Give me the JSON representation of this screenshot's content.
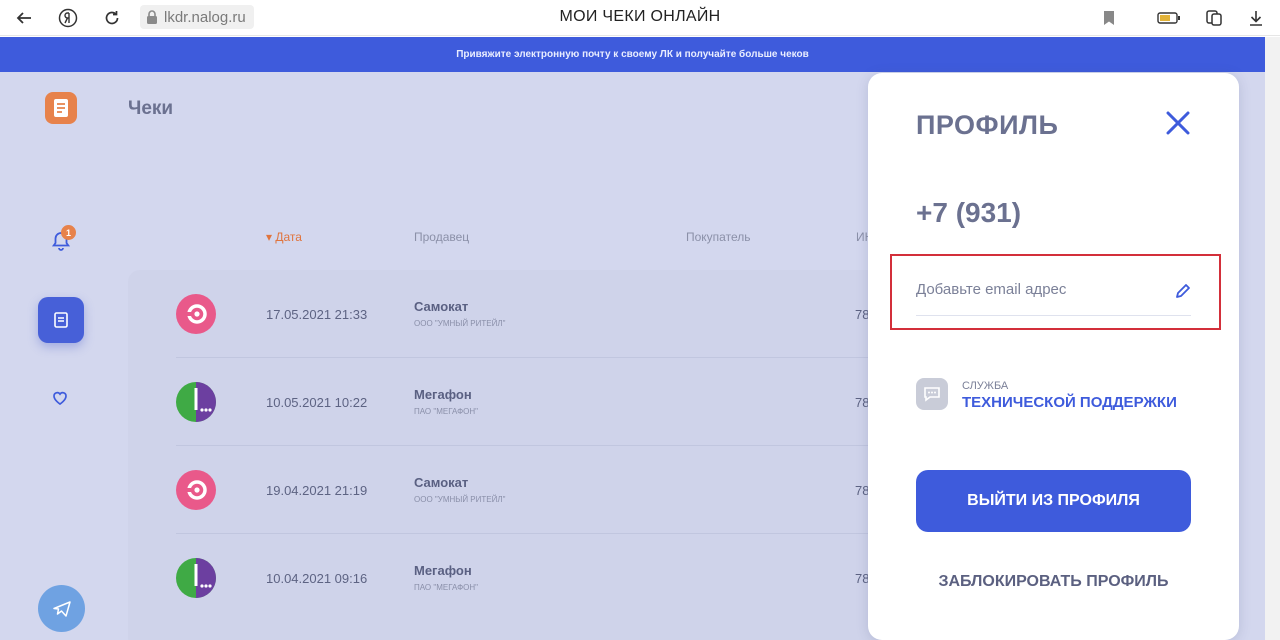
{
  "browser": {
    "url": "lkdr.nalog.ru",
    "title": "МОИ ЧЕКИ ОНЛАЙН"
  },
  "banner": {
    "text": "Привяжите электронную почту к своему ЛК и получайте больше чеков"
  },
  "header": {
    "title": "Чеки"
  },
  "sidebar": {
    "notifications_badge": "1"
  },
  "table": {
    "columns": {
      "date": "Дата",
      "seller": "Продавец",
      "buyer": "Покупатель",
      "inn": "ИН"
    },
    "rows": [
      {
        "date": "17.05.2021 21:33",
        "seller": "Самокат",
        "seller_org": "ООО \"УМНЫЙ РИТЕЙЛ\"",
        "inn": "78",
        "icon": "samokat-logo"
      },
      {
        "date": "10.05.2021 10:22",
        "seller": "Мегафон",
        "seller_org": "ПАО \"МЕГАФОН\"",
        "inn": "78",
        "icon": "megafon-logo"
      },
      {
        "date": "19.04.2021 21:19",
        "seller": "Самокат",
        "seller_org": "ООО \"УМНЫЙ РИТЕЙЛ\"",
        "inn": "78",
        "icon": "samokat-logo"
      },
      {
        "date": "10.04.2021 09:16",
        "seller": "Мегафон",
        "seller_org": "ПАО \"МЕГАФОН\"",
        "inn": "78",
        "icon": "megafon-logo"
      }
    ]
  },
  "profile": {
    "title": "ПРОФИЛЬ",
    "phone": "+7 (931)",
    "email_placeholder": "Добавьте email адрес",
    "support_small": "СЛУЖБА",
    "support_big": "ТЕХНИЧЕСКОЙ ПОДДЕРЖКИ",
    "logout_label": "ВЫЙТИ ИЗ ПРОФИЛЯ",
    "block_label": "ЗАБЛОКИРОВАТЬ ПРОФИЛЬ"
  },
  "colors": {
    "accent": "#3e5bdc",
    "orange": "#e7824b",
    "highlight_border": "#d32f3a"
  }
}
